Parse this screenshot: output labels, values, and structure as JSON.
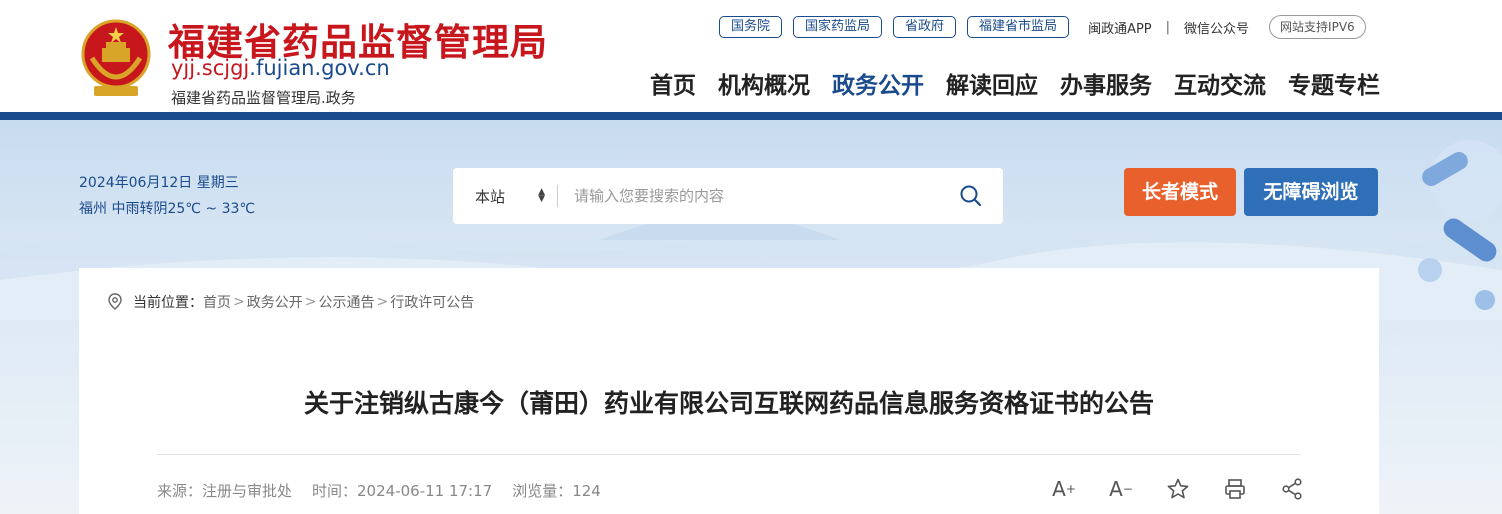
{
  "header": {
    "title": "福建省药品监督管理局",
    "domain_prefix": "yjj.scjgj",
    "domain_suffix": ".fujian.gov.cn",
    "subtitle": "福建省药品监督管理局.政务",
    "emblem_icon": "national-emblem-icon"
  },
  "top_links": {
    "chips": [
      "国务院",
      "国家药监局",
      "省政府",
      "福建省市监局"
    ],
    "app": "闽政通APP",
    "separator": "|",
    "wechat": "微信公众号",
    "ipv6": "网站支持IPV6"
  },
  "nav": {
    "items": [
      "首页",
      "机构概况",
      "政务公开",
      "解读回应",
      "办事服务",
      "互动交流",
      "专题专栏"
    ],
    "active_index": 2
  },
  "banner": {
    "date": "2024年06月12日 星期三",
    "weather": "福州 中雨转阴25℃ ~ 33℃",
    "search": {
      "scope": "本站",
      "placeholder": "请输入您要搜索的内容",
      "icon": "search-icon"
    },
    "elder_mode": "长者模式",
    "accessible": "无障碍浏览"
  },
  "breadcrumb": {
    "label": "当前位置：",
    "items": [
      "首页",
      "政务公开",
      "公示通告",
      "行政许可公告"
    ],
    "separator": ">"
  },
  "article": {
    "title": "关于注销纵古康今（莆田）药业有限公司互联网药品信息服务资格证书的公告",
    "source": "来源：注册与审批处",
    "time": "时间：2024-06-11 17:17",
    "views": "浏览量：124",
    "tools": [
      "font-increase-icon",
      "font-decrease-icon",
      "star-icon",
      "print-icon",
      "share-icon"
    ]
  },
  "colors": {
    "brand_red": "#c8161d",
    "brand_blue": "#1a4b8c",
    "elder_orange": "#e8612c",
    "access_blue": "#2f6fb8"
  }
}
